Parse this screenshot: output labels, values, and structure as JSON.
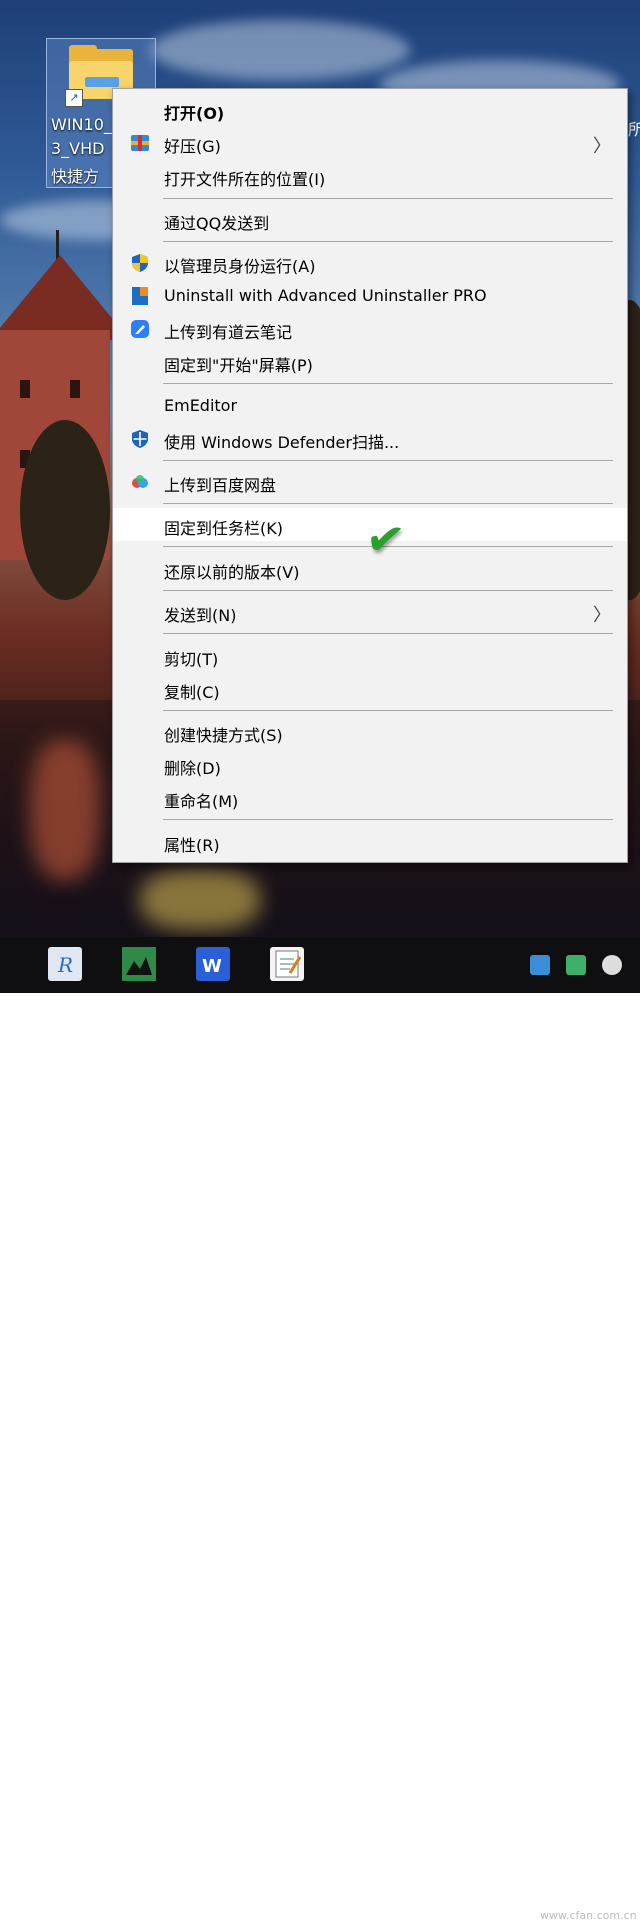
{
  "desktop_icon": {
    "label_lines": [
      "WIN10_",
      "3_VHD",
      "快捷方"
    ]
  },
  "desktop_edge_text": "所",
  "context_menu": {
    "groups": [
      [
        {
          "label": "打开(O)",
          "bold": true,
          "icon": "none"
        },
        {
          "label": "好压(G)",
          "icon": "haozip-archive-icon",
          "submenu": true
        },
        {
          "label": "打开文件所在的位置(I)",
          "icon": "none"
        }
      ],
      [
        {
          "label": "通过QQ发送到",
          "icon": "none"
        }
      ],
      [
        {
          "label": "以管理员身份运行(A)",
          "icon": "uac-shield-icon"
        },
        {
          "label": "Uninstall with Advanced Uninstaller PRO",
          "icon": "advanced-uninstaller-icon"
        },
        {
          "label": "上传到有道云笔记",
          "icon": "youdao-note-icon"
        },
        {
          "label": "固定到\"开始\"屏幕(P)",
          "icon": "none"
        }
      ],
      [
        {
          "label": "EmEditor",
          "icon": "none"
        },
        {
          "label": "使用 Windows Defender扫描...",
          "icon": "windows-defender-icon"
        }
      ],
      [
        {
          "label": "上传到百度网盘",
          "icon": "baidu-netdisk-icon"
        }
      ],
      [
        {
          "label": "固定到任务栏(K)",
          "icon": "none",
          "highlighted": true
        }
      ],
      [
        {
          "label": "还原以前的版本(V)",
          "icon": "none"
        }
      ],
      [
        {
          "label": "发送到(N)",
          "icon": "none",
          "submenu": true
        }
      ],
      [
        {
          "label": "剪切(T)",
          "icon": "none"
        },
        {
          "label": "复制(C)",
          "icon": "none"
        }
      ],
      [
        {
          "label": "创建快捷方式(S)",
          "icon": "none"
        },
        {
          "label": "删除(D)",
          "icon": "none"
        },
        {
          "label": "重命名(M)",
          "icon": "none"
        }
      ],
      [
        {
          "label": "属性(R)",
          "icon": "none"
        }
      ]
    ]
  },
  "annotation": {
    "checkmark": "✔",
    "color": "#27a12a"
  },
  "taskbar": {
    "apps": [
      "rainmeter-icon",
      "image-viewer-icon",
      "wps-icon",
      "notepad-icon"
    ],
    "tray": [
      "virtualbox-icon",
      "network-icon",
      "clock-icon"
    ]
  },
  "watermark": "www.cfan.com.cn",
  "colors": {
    "menu_bg": "#f2f2f2",
    "highlight": "#ffffff",
    "taskbar": "#0f0f12"
  }
}
